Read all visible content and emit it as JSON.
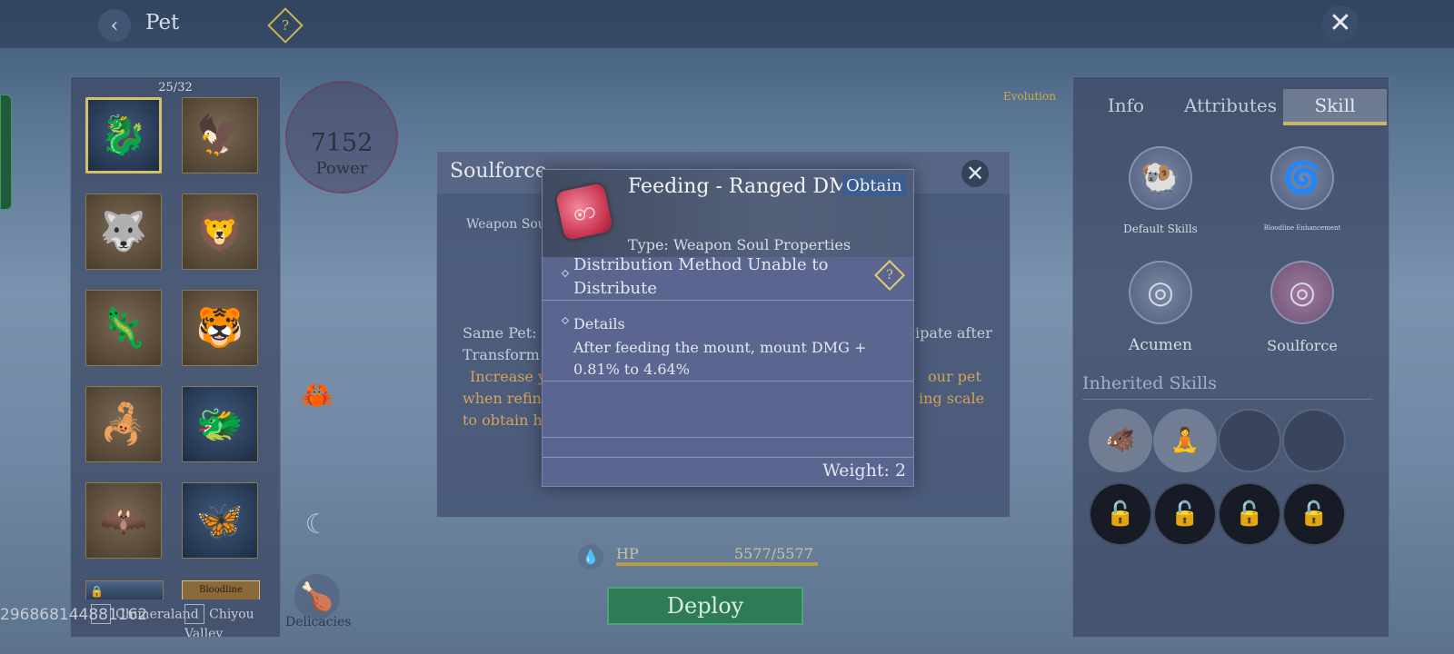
{
  "header": {
    "title": "Pet",
    "back_icon": "‹",
    "help_icon": "?",
    "close_icon": "✕"
  },
  "pet_list": {
    "count": "25/32",
    "slots": [
      {
        "icon": "🐉",
        "style": "blue",
        "selected": true
      },
      {
        "icon": "🦅",
        "style": "brown"
      },
      {
        "icon": "🐺",
        "style": "brown"
      },
      {
        "icon": "🦁",
        "style": "brown"
      },
      {
        "icon": "🦎",
        "style": "brown"
      },
      {
        "icon": "🐯",
        "style": "brown"
      },
      {
        "icon": "🦂",
        "style": "brown"
      },
      {
        "icon": "🐲",
        "style": "blue"
      },
      {
        "icon": "🦇",
        "style": "brown"
      },
      {
        "icon": "🦋",
        "style": "blue"
      }
    ],
    "bloodline_tag": "Bloodline",
    "regions": [
      "Chimeraland",
      "Chiyou Valley"
    ]
  },
  "player_id": "296868144881162",
  "power": {
    "value": "7152",
    "label": "Power"
  },
  "side_buttons": {
    "delicacies": "Delicacies"
  },
  "hp": {
    "label": "HP",
    "value": "5577/5577",
    "fill": 1.0
  },
  "deploy_label": "Deploy",
  "evolution_label": "Evolution",
  "right_panel": {
    "tabs": [
      {
        "label": "Info"
      },
      {
        "label": "Attributes"
      },
      {
        "label": "Skill",
        "active": true
      }
    ],
    "skills": [
      {
        "label": "Default Skills",
        "icon": "🐏"
      },
      {
        "label": "Bloodline Enhancement",
        "icon": "🌀"
      },
      {
        "label": "Acumen",
        "icon": "◎"
      },
      {
        "label": "Soulforce",
        "icon": "◎"
      }
    ],
    "inherited_title": "Inherited Skills",
    "lock_icon": "🔓"
  },
  "soulforce": {
    "title": "Soulforce",
    "weapon_label": "Weapon Sou",
    "line1_left": "Same Pet: F",
    "line1_right": "ipate after",
    "line2_left": "Transform",
    "orange1_left": "Increase y",
    "orange1_right": "our pet",
    "orange2_left": "when refin",
    "orange2_right": "ing scale",
    "orange3_left": "to obtain h"
  },
  "tooltip": {
    "title": "Feeding - Ranged DMG",
    "obtain": "Obtain",
    "type": "Type: Weapon Soul Properties",
    "distribution": "Distribution Method   Unable to Distribute",
    "details_header": "Details",
    "details": "After feeding the mount, mount DMG + 0.81% to 4.64%",
    "weight": "Weight: 2",
    "scroll_glyph": "ꩦ"
  }
}
